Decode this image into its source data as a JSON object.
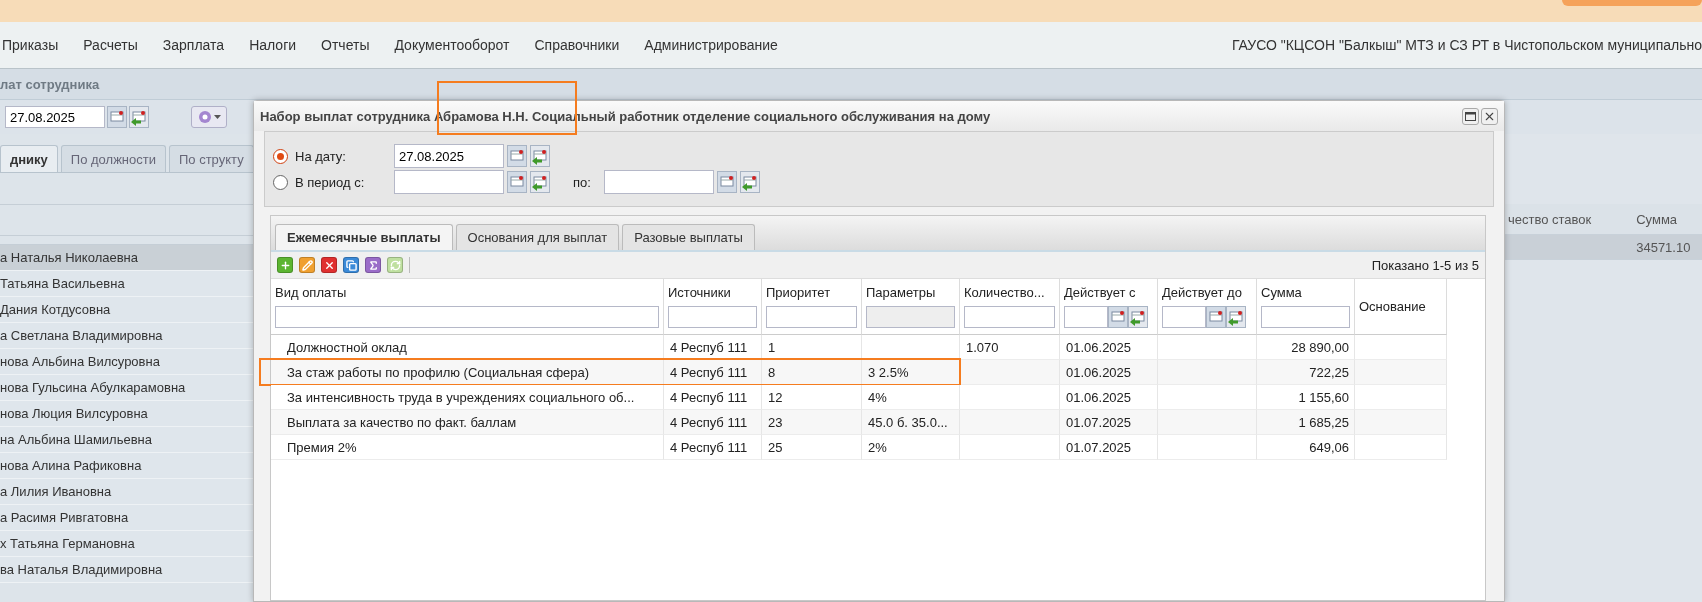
{
  "menu": {
    "items": [
      "Приказы",
      "Расчеты",
      "Зарплата",
      "Налоги",
      "Отчеты",
      "Документооборот",
      "Справочники",
      "Администрирование"
    ],
    "organization": "ГАУСО \"КЦСОН \"Балкыш\" МТЗ и СЗ РТ в Чистопольском муниципально"
  },
  "page": {
    "title": "лат сотрудника",
    "date": "27.08.2025"
  },
  "left_tabs": [
    {
      "label": "днику",
      "selected": true
    },
    {
      "label": "По должности",
      "selected": false
    },
    {
      "label": "По структу",
      "selected": false
    }
  ],
  "employees": [
    {
      "name": "а Наталья Николаевна",
      "selected": true
    },
    {
      "name": "Татьяна Васильевна",
      "selected": false
    },
    {
      "name": "Дания Котдусовна",
      "selected": false
    },
    {
      "name": "а Светлана Владимировна",
      "selected": false
    },
    {
      "name": "нова Альбина Вилсуровна",
      "selected": false
    },
    {
      "name": "нова Гульсина Абулкарамовна",
      "selected": false
    },
    {
      "name": "нова Люция Вилсуровна",
      "selected": false
    },
    {
      "name": "на Альбина Шамильевна",
      "selected": false
    },
    {
      "name": "нова Алина Рафиковна",
      "selected": false
    },
    {
      "name": "а Лилия Ивановна",
      "selected": false
    },
    {
      "name": "а Расимя Ривгатовна",
      "selected": false
    },
    {
      "name": "х Татьяна Германовна",
      "selected": false
    },
    {
      "name": "ва Наталья Владимировна",
      "selected": false
    }
  ],
  "background_grid": {
    "columns": [
      "чество ставок",
      "Сумма"
    ],
    "rows": [
      [
        "",
        "34571.10"
      ]
    ]
  },
  "dialog": {
    "title": "Набор выплат сотрудника Абрамова Н.Н. Социальный работник отделение социального обслуживания на дому",
    "date_mode": [
      {
        "label": "На дату:",
        "selected": true,
        "value": "27.08.2025"
      },
      {
        "label": "В период с:",
        "selected": false,
        "to_label": "по:"
      }
    ],
    "tabs": [
      {
        "label": "Ежемесячные выплаты",
        "selected": true
      },
      {
        "label": "Основания для выплат",
        "selected": false
      },
      {
        "label": "Разовые выплаты",
        "selected": false
      }
    ],
    "toolbar": [
      {
        "kind": "add"
      },
      {
        "kind": "edit"
      },
      {
        "kind": "delete"
      },
      {
        "kind": "copy"
      },
      {
        "kind": "sum"
      },
      {
        "kind": "refresh"
      }
    ],
    "paging": "Показано 1-5 из 5",
    "columns": [
      {
        "label": "Вид оплаты",
        "kind": "text"
      },
      {
        "label": "Источники",
        "kind": "text"
      },
      {
        "label": "Приоритет",
        "kind": "text"
      },
      {
        "label": "Параметры",
        "kind": "disabled"
      },
      {
        "label": "Количество...",
        "kind": "text"
      },
      {
        "label": "Действует с",
        "kind": "date"
      },
      {
        "label": "Действует до",
        "kind": "date"
      },
      {
        "label": "Сумма",
        "kind": "text"
      },
      {
        "label": "Основание",
        "kind": "plain"
      }
    ],
    "rows": [
      {
        "cells": [
          "Должностной оклад",
          "4 Респуб 111",
          "1",
          "",
          "1.070",
          "01.06.2025",
          "",
          "28 890,00",
          ""
        ],
        "highlighted": false
      },
      {
        "cells": [
          "За стаж работы по профилю (Социальная сфера)",
          "4 Респуб 111",
          "8",
          "3 2.5%",
          "",
          "01.06.2025",
          "",
          "722,25",
          ""
        ],
        "highlighted": true
      },
      {
        "cells": [
          "За интенсивность труда в учреждениях социального об...",
          "4 Респуб 111",
          "12",
          "4%",
          "",
          "01.06.2025",
          "",
          "1 155,60",
          ""
        ],
        "highlighted": false
      },
      {
        "cells": [
          "Выплата за качество по факт. баллам",
          "4 Респуб 111",
          "23",
          "45.0 б. 35.0...",
          "",
          "01.07.2025",
          "",
          "1 685,25",
          ""
        ],
        "highlighted": false
      },
      {
        "cells": [
          "Премия 2%",
          "4 Респуб 111",
          "25",
          "2%",
          "",
          "01.07.2025",
          "",
          "649,06",
          ""
        ],
        "highlighted": false
      }
    ]
  }
}
